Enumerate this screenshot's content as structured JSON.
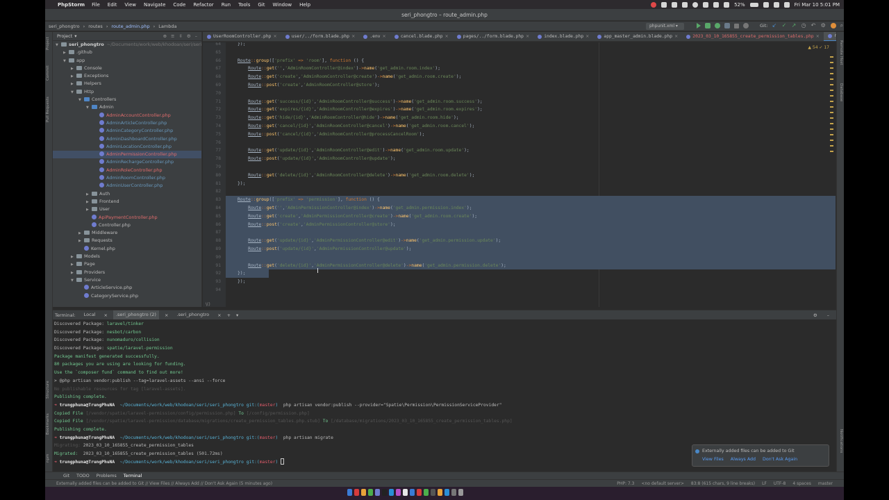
{
  "menubar": {
    "app_name": "PhpStorm",
    "items": [
      "File",
      "Edit",
      "View",
      "Navigate",
      "Code",
      "Refactor",
      "Run",
      "Tools",
      "Git",
      "Window",
      "Help"
    ],
    "battery": "52%",
    "clock": "Fri Mar 10  5:01 PM"
  },
  "window": {
    "title": "seri_phongtro – route_admin.php"
  },
  "navbar": {
    "crumbs": [
      "seri_phongtro",
      "routes",
      "route_admin.php",
      "Lambda"
    ],
    "run_config": "phpunit.xml",
    "git_label": "Git:"
  },
  "project": {
    "header": "Project",
    "tree": [
      {
        "indent": 0,
        "kind": "folder",
        "name": "seri_phongtro",
        "path": "~/Documents/work/web/khodoan/seri/seri_",
        "style": "bold",
        "open": true
      },
      {
        "indent": 1,
        "kind": "folder",
        "name": ".github",
        "open": false
      },
      {
        "indent": 1,
        "kind": "folder",
        "name": "app",
        "open": true
      },
      {
        "indent": 2,
        "kind": "folder",
        "name": "Console",
        "open": false
      },
      {
        "indent": 2,
        "kind": "folder",
        "name": "Exceptions",
        "open": false
      },
      {
        "indent": 2,
        "kind": "folder",
        "name": "Helpers",
        "open": false
      },
      {
        "indent": 2,
        "kind": "folder",
        "name": "Http",
        "open": true
      },
      {
        "indent": 3,
        "kind": "folder",
        "name": "Controllers",
        "open": true
      },
      {
        "indent": 4,
        "kind": "folder",
        "name": "Admin",
        "open": true
      },
      {
        "indent": 5,
        "kind": "php",
        "name": "AdminAccountController.php",
        "style": "red"
      },
      {
        "indent": 5,
        "kind": "php",
        "name": "AdminArticleController.php",
        "style": "blue"
      },
      {
        "indent": 5,
        "kind": "php",
        "name": "AdminCategoryController.php",
        "style": "blue"
      },
      {
        "indent": 5,
        "kind": "php",
        "name": "AdminDashboardController.php",
        "style": "blue"
      },
      {
        "indent": 5,
        "kind": "php",
        "name": "AdminLocationController.php",
        "style": "blue"
      },
      {
        "indent": 5,
        "kind": "php",
        "name": "AdminPermissionController.php",
        "style": "red",
        "selected": true
      },
      {
        "indent": 5,
        "kind": "php",
        "name": "AdminRechargeController.php",
        "style": "blue"
      },
      {
        "indent": 5,
        "kind": "php",
        "name": "AdminRoleController.php",
        "style": "red"
      },
      {
        "indent": 5,
        "kind": "php",
        "name": "AdminRoomController.php",
        "style": "blue"
      },
      {
        "indent": 5,
        "kind": "php",
        "name": "AdminUserController.php",
        "style": "blue"
      },
      {
        "indent": 4,
        "kind": "folder",
        "name": "Auth",
        "open": false
      },
      {
        "indent": 4,
        "kind": "folder",
        "name": "Frontend",
        "open": false
      },
      {
        "indent": 4,
        "kind": "folder",
        "name": "User",
        "open": false
      },
      {
        "indent": 4,
        "kind": "php",
        "name": "ApiPaymentController.php",
        "style": "red"
      },
      {
        "indent": 4,
        "kind": "php",
        "name": "Controller.php",
        "style": ""
      },
      {
        "indent": 3,
        "kind": "folder",
        "name": "Middleware",
        "open": false
      },
      {
        "indent": 3,
        "kind": "folder",
        "name": "Requests",
        "open": false
      },
      {
        "indent": 3,
        "kind": "php",
        "name": "Kernel.php",
        "style": ""
      },
      {
        "indent": 2,
        "kind": "folder",
        "name": "Models",
        "open": false
      },
      {
        "indent": 2,
        "kind": "folder",
        "name": "Page",
        "open": false
      },
      {
        "indent": 2,
        "kind": "folder",
        "name": "Providers",
        "open": false
      },
      {
        "indent": 2,
        "kind": "folder",
        "name": "Service",
        "open": true
      },
      {
        "indent": 3,
        "kind": "php",
        "name": "ArticleService.php",
        "style": ""
      },
      {
        "indent": 3,
        "kind": "php",
        "name": "CategoryService.php",
        "style": ""
      }
    ]
  },
  "editor_tabs": [
    {
      "label": "UserRoomController.php",
      "style": ""
    },
    {
      "label": "user/../form.blade.php",
      "style": ""
    },
    {
      "label": ".env",
      "style": ""
    },
    {
      "label": "cancel.blade.php",
      "style": ""
    },
    {
      "label": "pages/../form.blade.php",
      "style": ""
    },
    {
      "label": "index.blade.php",
      "style": ""
    },
    {
      "label": "app_master_admin.blade.php",
      "style": ""
    },
    {
      "label": "2023_03_10_165855_create_permission_tables.php",
      "style": "red"
    },
    {
      "label": "route_admin.php",
      "style": "active"
    },
    {
      "label": "Ro",
      "style": ""
    }
  ],
  "editor": {
    "inspection": "▲ 54  ✓ 17",
    "lines": [
      {
        "n": "64",
        "code": "});"
      },
      {
        "n": "65",
        "code": ""
      },
      {
        "n": "66",
        "code": "Route::group(['prefix' => 'room'], function () {"
      },
      {
        "n": "67",
        "code": "    Route::get('','AdminRoomController@index')->name('get_admin.room.index');"
      },
      {
        "n": "68",
        "code": "    Route::get('create','AdminRoomController@create')->name('get_admin.room.create');"
      },
      {
        "n": "69",
        "code": "    Route::post('create','AdminRoomController@store');"
      },
      {
        "n": "70",
        "code": ""
      },
      {
        "n": "71",
        "code": "    Route::get('success/{id}','AdminRoomController@success')->name('get_admin.room.success');"
      },
      {
        "n": "72",
        "code": "    Route::get('expires/{id}','AdminRoomController@expires')->name('get_admin.room.expires');"
      },
      {
        "n": "73",
        "code": "    Route::get('hide/{id}','AdminRoomController@hide')->name('get_admin.room.hide');"
      },
      {
        "n": "74",
        "code": "    Route::get('cancel/{id}','AdminRoomController@cancel')->name('get_admin.room.cancel');"
      },
      {
        "n": "75",
        "code": "    Route::post('cancel/{id}','AdminRoomController@processCancelRoom');"
      },
      {
        "n": "76",
        "code": ""
      },
      {
        "n": "77",
        "code": "    Route::get('update/{id}','AdminRoomController@edit')->name('get_admin.room.update');"
      },
      {
        "n": "78",
        "code": "    Route::post('update/{id}','AdminRoomController@update');"
      },
      {
        "n": "79",
        "code": ""
      },
      {
        "n": "80",
        "code": "    Route::get('delete/{id}','AdminRoomController@delete')->name('get_admin.room.delete');"
      },
      {
        "n": "81",
        "code": "});"
      },
      {
        "n": "82",
        "code": ""
      },
      {
        "n": "83",
        "code": "Route::group(['prefix' => 'permission'], function () {"
      },
      {
        "n": "84",
        "code": "    Route::get('','AdminPermissionController@index')->name('get_admin.permission.index');"
      },
      {
        "n": "85",
        "code": "    Route::get('create','AdminPermissionController@create')->name('get_admin.room.create');"
      },
      {
        "n": "86",
        "code": "    Route::post('create','AdminPermissionController@store');"
      },
      {
        "n": "87",
        "code": ""
      },
      {
        "n": "88",
        "code": "    Route::get('update/{id}','AdminPermissionController@edit')->name('get_admin.permission.update');"
      },
      {
        "n": "89",
        "code": "    Route::post('update/{id}','AdminPermissionController@update');"
      },
      {
        "n": "90",
        "code": ""
      },
      {
        "n": "91",
        "code": "    Route::get('delete/{id}','AdminPermissionController@delete')->name('get_admin.permission.delete');"
      },
      {
        "n": "92",
        "code": "});"
      },
      {
        "n": "93",
        "code": "});"
      },
      {
        "n": "94",
        "code": ""
      }
    ],
    "footer": "\\()"
  },
  "terminal": {
    "label": "Terminal:",
    "tabs": [
      "Local",
      ".seri_phongtro (2)",
      ".seri_phongtro"
    ],
    "lines": [
      [
        {
          "t": "Discovered Package: ",
          "c": ""
        },
        {
          "t": "laravel/tinker",
          "c": "g"
        }
      ],
      [
        {
          "t": "Discovered Package: ",
          "c": ""
        },
        {
          "t": "nesbot/carbon",
          "c": "g"
        }
      ],
      [
        {
          "t": "Discovered Package: ",
          "c": ""
        },
        {
          "t": "nunomaduro/collision",
          "c": "g"
        }
      ],
      [
        {
          "t": "Discovered Package: ",
          "c": ""
        },
        {
          "t": "spatie/laravel-permission",
          "c": "g"
        }
      ],
      [
        {
          "t": "Package manifest generated successfully.",
          "c": "g"
        }
      ],
      [
        {
          "t": "80 packages you are using are looking for funding.",
          "c": "g"
        }
      ],
      [
        {
          "t": "Use the `composer fund` command to find out more!",
          "c": "g"
        }
      ],
      [
        {
          "t": "> @php artisan vendor:publish --tag=laravel-assets --ansi --force",
          "c": ""
        }
      ],
      [
        {
          "t": "No publishable resources for tag [laravel-assets].",
          "c": "dim"
        }
      ],
      [
        {
          "t": "Publishing complete.",
          "c": "g"
        }
      ],
      [
        {
          "t": "➜ ",
          "c": "r"
        },
        {
          "t": "trungphuna@TrungPhuNA ",
          "c": "w"
        },
        {
          "t": " ~/Documents/work/web/khodoan/seri/seri_phongtro ",
          "c": "c"
        },
        {
          "t": "git:(",
          "c": "c"
        },
        {
          "t": "master",
          "c": "r"
        },
        {
          "t": ")",
          "c": "c"
        },
        {
          "t": "  php artisan vendor:publish --provider=\"Spatie\\Permission\\PermissionServiceProvider\"",
          "c": ""
        }
      ],
      [
        {
          "t": "Copied File ",
          "c": "g"
        },
        {
          "t": "[/vendor/spatie/laravel-permission/config/permission.php]",
          "c": "dim"
        },
        {
          "t": " To ",
          "c": "g"
        },
        {
          "t": "[/config/permission.php]",
          "c": "dim"
        }
      ],
      [
        {
          "t": "Copied File ",
          "c": "g"
        },
        {
          "t": "[/vendor/spatie/laravel-permission/database/migrations/create_permission_tables.php.stub]",
          "c": "dim"
        },
        {
          "t": " To ",
          "c": "g"
        },
        {
          "t": "[/database/migrations/2023_03_10_165855_create_permission_tables.php]",
          "c": "dim"
        }
      ],
      [
        {
          "t": "Publishing complete.",
          "c": "g"
        }
      ],
      [
        {
          "t": "➜ ",
          "c": "r"
        },
        {
          "t": "trungphuna@TrungPhuNA ",
          "c": "w"
        },
        {
          "t": " ~/Documents/work/web/khodoan/seri/seri_phongtro ",
          "c": "c"
        },
        {
          "t": "git:(",
          "c": "c"
        },
        {
          "t": "master",
          "c": "r"
        },
        {
          "t": ")",
          "c": "c"
        },
        {
          "t": "  php artisan migrate",
          "c": ""
        }
      ],
      [
        {
          "t": "Migrating: ",
          "c": "dim"
        },
        {
          "t": "2023_03_10_165855_create_permission_tables",
          "c": ""
        }
      ],
      [
        {
          "t": "Migrated:  ",
          "c": "g"
        },
        {
          "t": "2023_03_10_165855_create_permission_tables (501.72ms)",
          "c": ""
        }
      ],
      [
        {
          "t": "➜ ",
          "c": "r"
        },
        {
          "t": "trungphuna@TrungPhuNA ",
          "c": "w"
        },
        {
          "t": " ~/Documents/work/web/khodoan/seri/seri_phongtro ",
          "c": "c"
        },
        {
          "t": "git:(",
          "c": "c"
        },
        {
          "t": "master",
          "c": "r"
        },
        {
          "t": ")",
          "c": "c"
        },
        {
          "t": " ",
          "c": ""
        }
      ]
    ]
  },
  "notification": {
    "message": "Externally added files can be added to Git",
    "actions": [
      "View Files",
      "Always Add",
      "Don't Ask Again"
    ]
  },
  "bottom_tools": [
    "Git",
    "TODO",
    "Problems",
    "Terminal"
  ],
  "status": {
    "message": "Externally added files can be added to Git // View Files // Always Add // Don't Ask Again (5 minutes ago)",
    "php": "PHP: 7.3",
    "server": "<no default server>",
    "position": "83:8 (615 chars, 9 line breaks)",
    "line_sep": "LF",
    "encoding": "UTF-8",
    "indent": "4 spaces",
    "branch": "master"
  },
  "left_strip": [
    "Project",
    "Commit",
    "Pull Requests",
    "Structure",
    "Bookmarks",
    "npm"
  ],
  "right_strip": [
    "Remote Host",
    "Database",
    "Notifications"
  ]
}
